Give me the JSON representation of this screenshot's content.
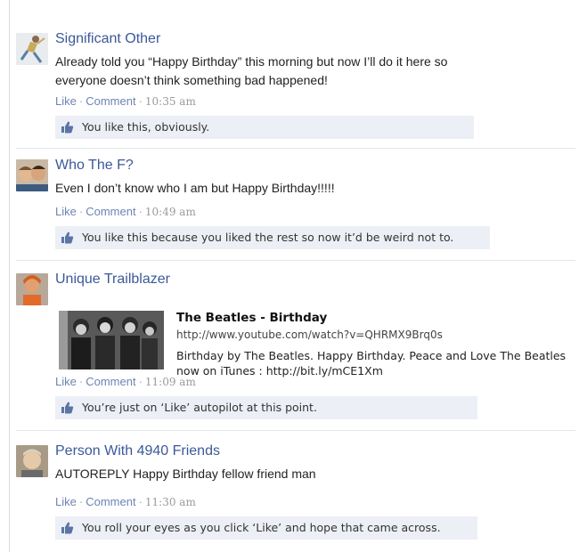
{
  "posts": [
    {
      "author": "Significant Other",
      "message": "Already told you “Happy Birthday” this morning but now I’ll do it here so everyone doesn’t think something bad happened!",
      "actions": {
        "like": "Like",
        "comment": "Comment",
        "time": "10:35 am"
      },
      "like_text": "You like this, obviously."
    },
    {
      "author": "Who The F?",
      "message": "Even I don’t know who I am but Happy Birthday!!!!!",
      "actions": {
        "like": "Like",
        "comment": "Comment",
        "time": "10:49 am"
      },
      "like_text": "You like this because you liked the rest so now it’d be weird not to."
    },
    {
      "author": "Unique Trailblazer",
      "shared_link": {
        "title": "The Beatles - Birthday",
        "url": "http://www.youtube.com/watch?v=QHRMX9Brq0s",
        "description": "Birthday by The Beatles. Happy Birthday. Peace and Love The Beatles now on iTunes : http://bit.ly/mCE1Xm"
      },
      "actions": {
        "like": "Like",
        "comment": "Comment",
        "time": "11:09 am"
      },
      "like_text": "You’re just on ‘Like’ autopilot at this point."
    },
    {
      "author": "Person With 4940 Friends",
      "message": "AUTOREPLY Happy Birthday fellow friend man",
      "actions": {
        "like": "Like",
        "comment": "Comment",
        "time": "11:30 am"
      },
      "like_text": "You roll your eyes as you click ‘Like’ and hope that came across."
    }
  ],
  "icons": {
    "like": "thumbs-up-icon"
  },
  "colors": {
    "link": "#3b5998",
    "like_bar": "#eceff5",
    "meta": "#6d84b4"
  }
}
